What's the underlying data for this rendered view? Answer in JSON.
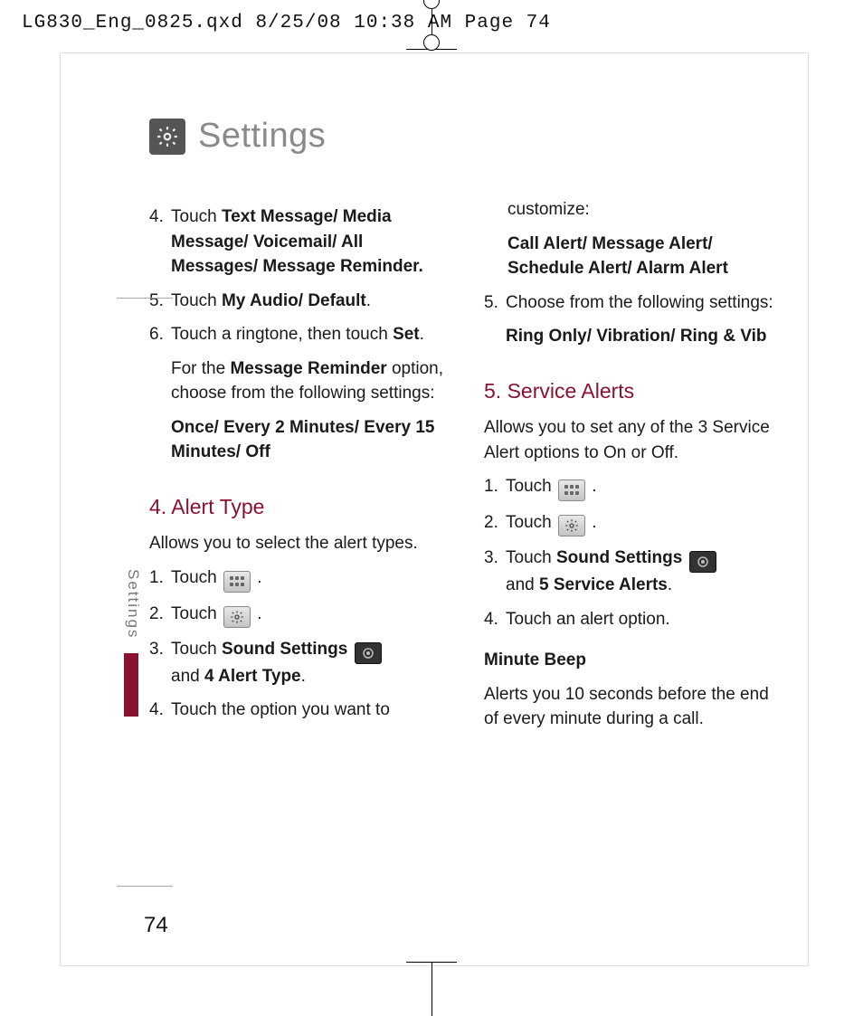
{
  "slug": "LG830_Eng_0825.qxd  8/25/08  10:38 AM  Page 74",
  "title": "Settings",
  "side_tab": "Settings",
  "page_number": "74",
  "left": {
    "step4": {
      "num": "4.",
      "pre": "Touch ",
      "bold": "Text Message/ Media Message/ Voicemail/ All Messages/ Message Reminder."
    },
    "step5": {
      "num": "5.",
      "pre": "Touch ",
      "bold": "My Audio/ Default",
      "post": "."
    },
    "step6": {
      "num": "6.",
      "line1_pre": "Touch a ringtone, then touch ",
      "line1_bold": "Set",
      "line1_post": ".",
      "line2_pre": "For the ",
      "line2_bold": "Message Reminder",
      "line2_post": " option, choose from the following settings:",
      "line3_bold": "Once/ Every 2 Minutes/ Every 15 Minutes/ Off"
    },
    "alert_type": {
      "heading": "4. Alert Type",
      "intro": "Allows you to select the alert types.",
      "s1": {
        "num": "1.",
        "pre": "Touch ",
        "post": "."
      },
      "s2": {
        "num": "2.",
        "pre": "Touch ",
        "post": "."
      },
      "s3": {
        "num": "3.",
        "pre": "Touch ",
        "bold1": "Sound Settings",
        "mid": " and ",
        "bold2": "4 Alert Type",
        "post": "."
      },
      "s4": {
        "num": "4.",
        "text": "Touch the option you want to"
      }
    }
  },
  "right": {
    "customize": {
      "line1": "customize:",
      "bold": "Call Alert/ Message Alert/ Schedule Alert/ Alarm Alert"
    },
    "step5": {
      "num": "5.",
      "text": "Choose from the following settings:",
      "bold": "Ring Only/ Vibration/ Ring & Vib"
    },
    "service_alerts": {
      "heading": "5. Service Alerts",
      "intro": "Allows you to set any of the 3 Service Alert options to On or Off.",
      "s1": {
        "num": "1.",
        "pre": "Touch ",
        "post": "."
      },
      "s2": {
        "num": "2.",
        "pre": "Touch ",
        "post": "."
      },
      "s3": {
        "num": "3.",
        "pre": "Touch ",
        "bold1": "Sound Settings",
        "mid": " and ",
        "bold2": "5 Service Alerts",
        "post": "."
      },
      "s4": {
        "num": "4.",
        "text": "Touch an alert option."
      }
    },
    "minute_beep": {
      "heading": "Minute Beep",
      "text": "Alerts you 10 seconds before the end of every minute during a call."
    }
  }
}
